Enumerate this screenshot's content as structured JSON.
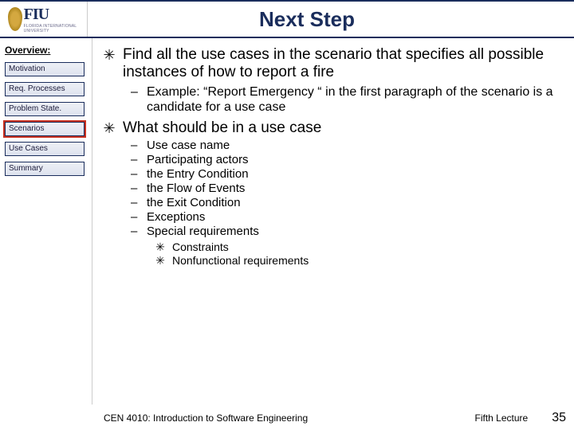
{
  "header": {
    "logo_text": "FIU",
    "logo_sub": "FLORIDA INTERNATIONAL UNIVERSITY",
    "title": "Next Step"
  },
  "sidebar": {
    "title": "Overview:",
    "items": [
      {
        "label": "Motivation",
        "active": false
      },
      {
        "label": "Req. Processes",
        "active": false
      },
      {
        "label": "Problem State.",
        "active": false
      },
      {
        "label": "Scenarios",
        "active": true
      },
      {
        "label": "Use Cases",
        "active": false
      },
      {
        "label": "Summary",
        "active": false
      }
    ]
  },
  "content": {
    "p1": "Find all the use cases in the scenario that specifies all possible instances of how to report a fire",
    "p1_sub": "Example: “Report Emergency “ in the first paragraph of the scenario is a candidate for a use case",
    "p2": "What should be in a use case",
    "p2_items": [
      "Use case name",
      "Participating actors",
      "the Entry Condition",
      "the Flow of Events",
      "the Exit Condition",
      "Exceptions",
      "Special requirements"
    ],
    "p2_sub_items": [
      "Constraints",
      "Nonfunctional requirements"
    ]
  },
  "footer": {
    "course": "CEN 4010: Introduction to Software Engineering",
    "lecture": "Fifth Lecture",
    "page": "35"
  }
}
